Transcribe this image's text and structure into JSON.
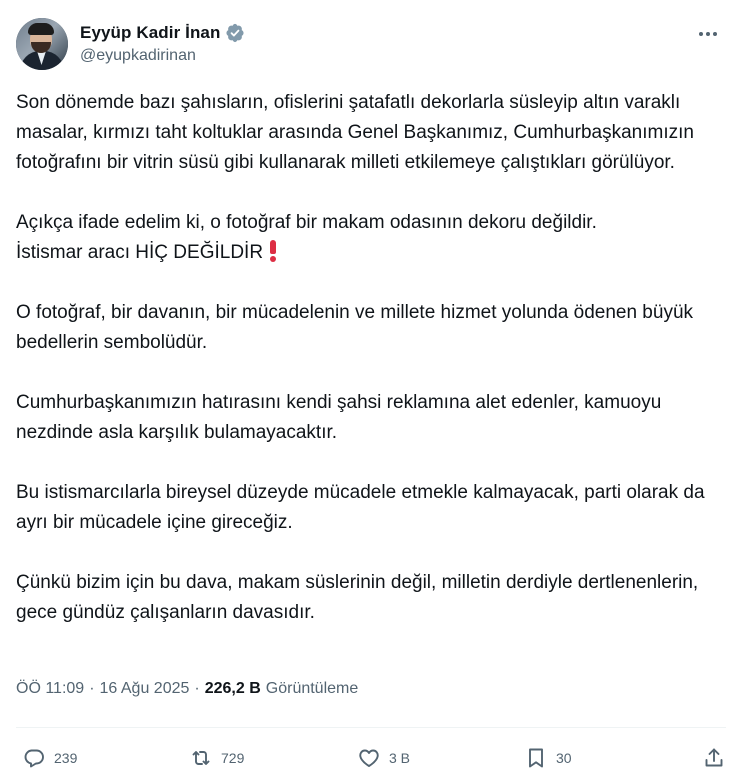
{
  "author": {
    "name": "Eyyüp Kadir İnan",
    "handle": "@eyupkadirinan",
    "verified": true
  },
  "icons": {
    "more": "more-horizontal-icon",
    "verified": "verified-badge-icon",
    "reply": "reply-icon",
    "retweet": "retweet-icon",
    "like": "heart-icon",
    "bookmark": "bookmark-icon",
    "share": "share-icon",
    "emphasis": "red-exclamation-icon"
  },
  "colors": {
    "text": "#0f1419",
    "secondary": "#536471",
    "verified": "#829aab",
    "exclamation": "#dd2e44",
    "divider": "#eff3f4"
  },
  "tweet": {
    "paragraphs": [
      "Son dönemde bazı şahısların, ofislerini şatafatlı dekorlarla süsleyip altın varaklı masalar, kırmızı taht koltuklar arasında Genel Başkanımız, Cumhurbaşkanımızın fotoğrafını bir vitrin süsü gibi kullanarak milleti etkilemeye çalıştıkları görülüyor.",
      "Açıkça ifade edelim ki, o fotoğraf bir makam odasının dekoru değildir.\nİstismar aracı HİÇ DEĞİLDİR",
      "O fotoğraf, bir davanın, bir mücadelenin ve millete hizmet yolunda ödenen büyük bedellerin sembolüdür.",
      "Cumhurbaşkanımızın hatırasını kendi şahsi reklamına alet edenler, kamuoyu nezdinde asla karşılık bulamayacaktır.",
      "Bu istismarcılarla bireysel düzeyde mücadele etmekle kalmayacak, parti olarak da ayrı bir mücadele içine gireceğiz.",
      "Çünkü bizim için bu dava, makam süslerinin değil, milletin derdiyle dertlenenlerin, gece gündüz çalışanların davasıdır."
    ]
  },
  "meta": {
    "time": "ÖÖ 11:09",
    "separator": "·",
    "date": "16 Ağu 2025",
    "views_count": "226,2 B",
    "views_label": "Görüntüleme"
  },
  "actions": {
    "replies": "239",
    "retweets": "729",
    "likes": "3 B",
    "bookmarks": "30"
  }
}
